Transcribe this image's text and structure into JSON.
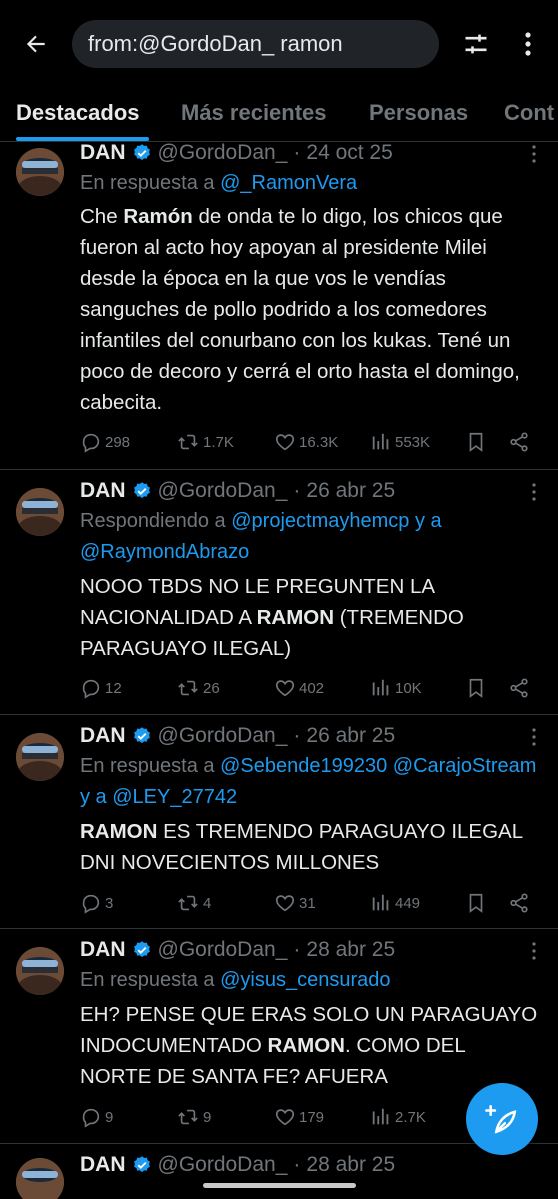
{
  "search": {
    "query": "from:@GordoDan_ ramon"
  },
  "tabs": [
    {
      "label": "Destacados",
      "active": true
    },
    {
      "label": "Más recientes",
      "active": false
    },
    {
      "label": "Personas",
      "active": false
    },
    {
      "label": "Cont",
      "active": false
    }
  ],
  "tweets": [
    {
      "name": "DAN",
      "handle": "@GordoDan_",
      "date": "24 oct 25",
      "reply_prefix": "En respuesta a",
      "reply_mentions": "@_RamonVera",
      "body_pre": "Che ",
      "body_bold": "Ramón",
      "body_post": " de onda te lo digo, los chicos que fueron al acto hoy apoyan al presidente Milei desde la época en la que vos le vendías sanguches de pollo podrido a los comedores infantiles del conurbano con los kukas. Tené un poco de decoro y cerrá el orto hasta el domingo, cabecita.",
      "replies": "298",
      "reposts": "1.7K",
      "likes": "16.3K",
      "views": "553K"
    },
    {
      "name": "DAN",
      "handle": "@GordoDan_",
      "date": "26 abr 25",
      "reply_prefix": "Respondiendo a",
      "reply_mentions": "@projectmayhemcp y a @RaymondAbrazo",
      "body_pre": "NOOO TBDS NO LE PREGUNTEN LA NACIONALIDAD A ",
      "body_bold": "RAMON",
      "body_post": " (TREMENDO PARAGUAYO ILEGAL)",
      "replies": "12",
      "reposts": "26",
      "likes": "402",
      "views": "10K"
    },
    {
      "name": "DAN",
      "handle": "@GordoDan_",
      "date": "26 abr 25",
      "reply_prefix": "En respuesta a",
      "reply_mentions": "@Sebende199230 @CarajoStream y a @LEY_27742",
      "body_pre": "",
      "body_bold": "RAMON",
      "body_post": " ES TREMENDO PARAGUAYO ILEGAL DNI NOVECIENTOS MILLONES",
      "replies": "3",
      "reposts": "4",
      "likes": "31",
      "views": "449"
    },
    {
      "name": "DAN",
      "handle": "@GordoDan_",
      "date": "28 abr 25",
      "reply_prefix": "En respuesta a",
      "reply_mentions": "@yisus_censurado",
      "body_pre": "EH? PENSE QUE ERAS SOLO UN PARAGUAYO INDOCUMENTADO ",
      "body_bold": "RAMON",
      "body_post": ". COMO DEL NORTE DE SANTA FE? AFUERA",
      "replies": "9",
      "reposts": "9",
      "likes": "179",
      "views": "2.7K"
    },
    {
      "name": "DAN",
      "handle": "@GordoDan_",
      "date": "28 abr 25"
    }
  ],
  "colors": {
    "accent": "#1d9bf0",
    "background": "#000000",
    "muted": "#71767b",
    "text": "#e7e9ea"
  }
}
